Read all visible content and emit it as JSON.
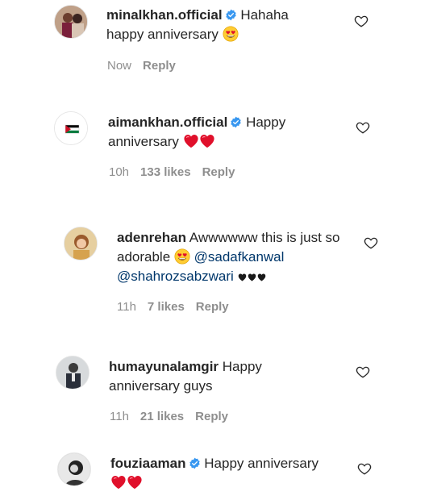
{
  "comments": [
    {
      "username": "minalkhan.official",
      "verified": true,
      "text_before": "Hahaha",
      "text_line2": "happy anniversary",
      "time": "Now",
      "likes": "",
      "reply": "Reply"
    },
    {
      "username": "aimankhan.official",
      "verified": true,
      "text_before": "Happy",
      "text_line2": "anniversary",
      "time": "10h",
      "likes": "133 likes",
      "reply": "Reply"
    },
    {
      "username": "adenrehan",
      "verified": false,
      "text_before": "Awwwwww this is just so",
      "text_line2": "adorable",
      "mention1": "@sadafkanwal",
      "mention2": "@shahrozsabzwari",
      "time": "11h",
      "likes": "7 likes",
      "reply": "Reply"
    },
    {
      "username": "humayunalamgir",
      "verified": false,
      "text_before": "Happy",
      "text_line2": "anniversary guys",
      "time": "11h",
      "likes": "21 likes",
      "reply": "Reply"
    },
    {
      "username": "fouziaaman",
      "verified": true,
      "text_before": "Happy anniversary",
      "time": "",
      "likes": "",
      "reply": ""
    }
  ],
  "colors": {
    "text": "#262626",
    "meta": "#8e8e8e",
    "mention": "#00376b",
    "verified": "#3897f0",
    "heart_red": "#e0102b"
  },
  "icons": [
    "like-heart-icon",
    "verified-badge-icon",
    "heart-eyes-emoji",
    "red-heart-emoji",
    "black-heart-emoji"
  ]
}
